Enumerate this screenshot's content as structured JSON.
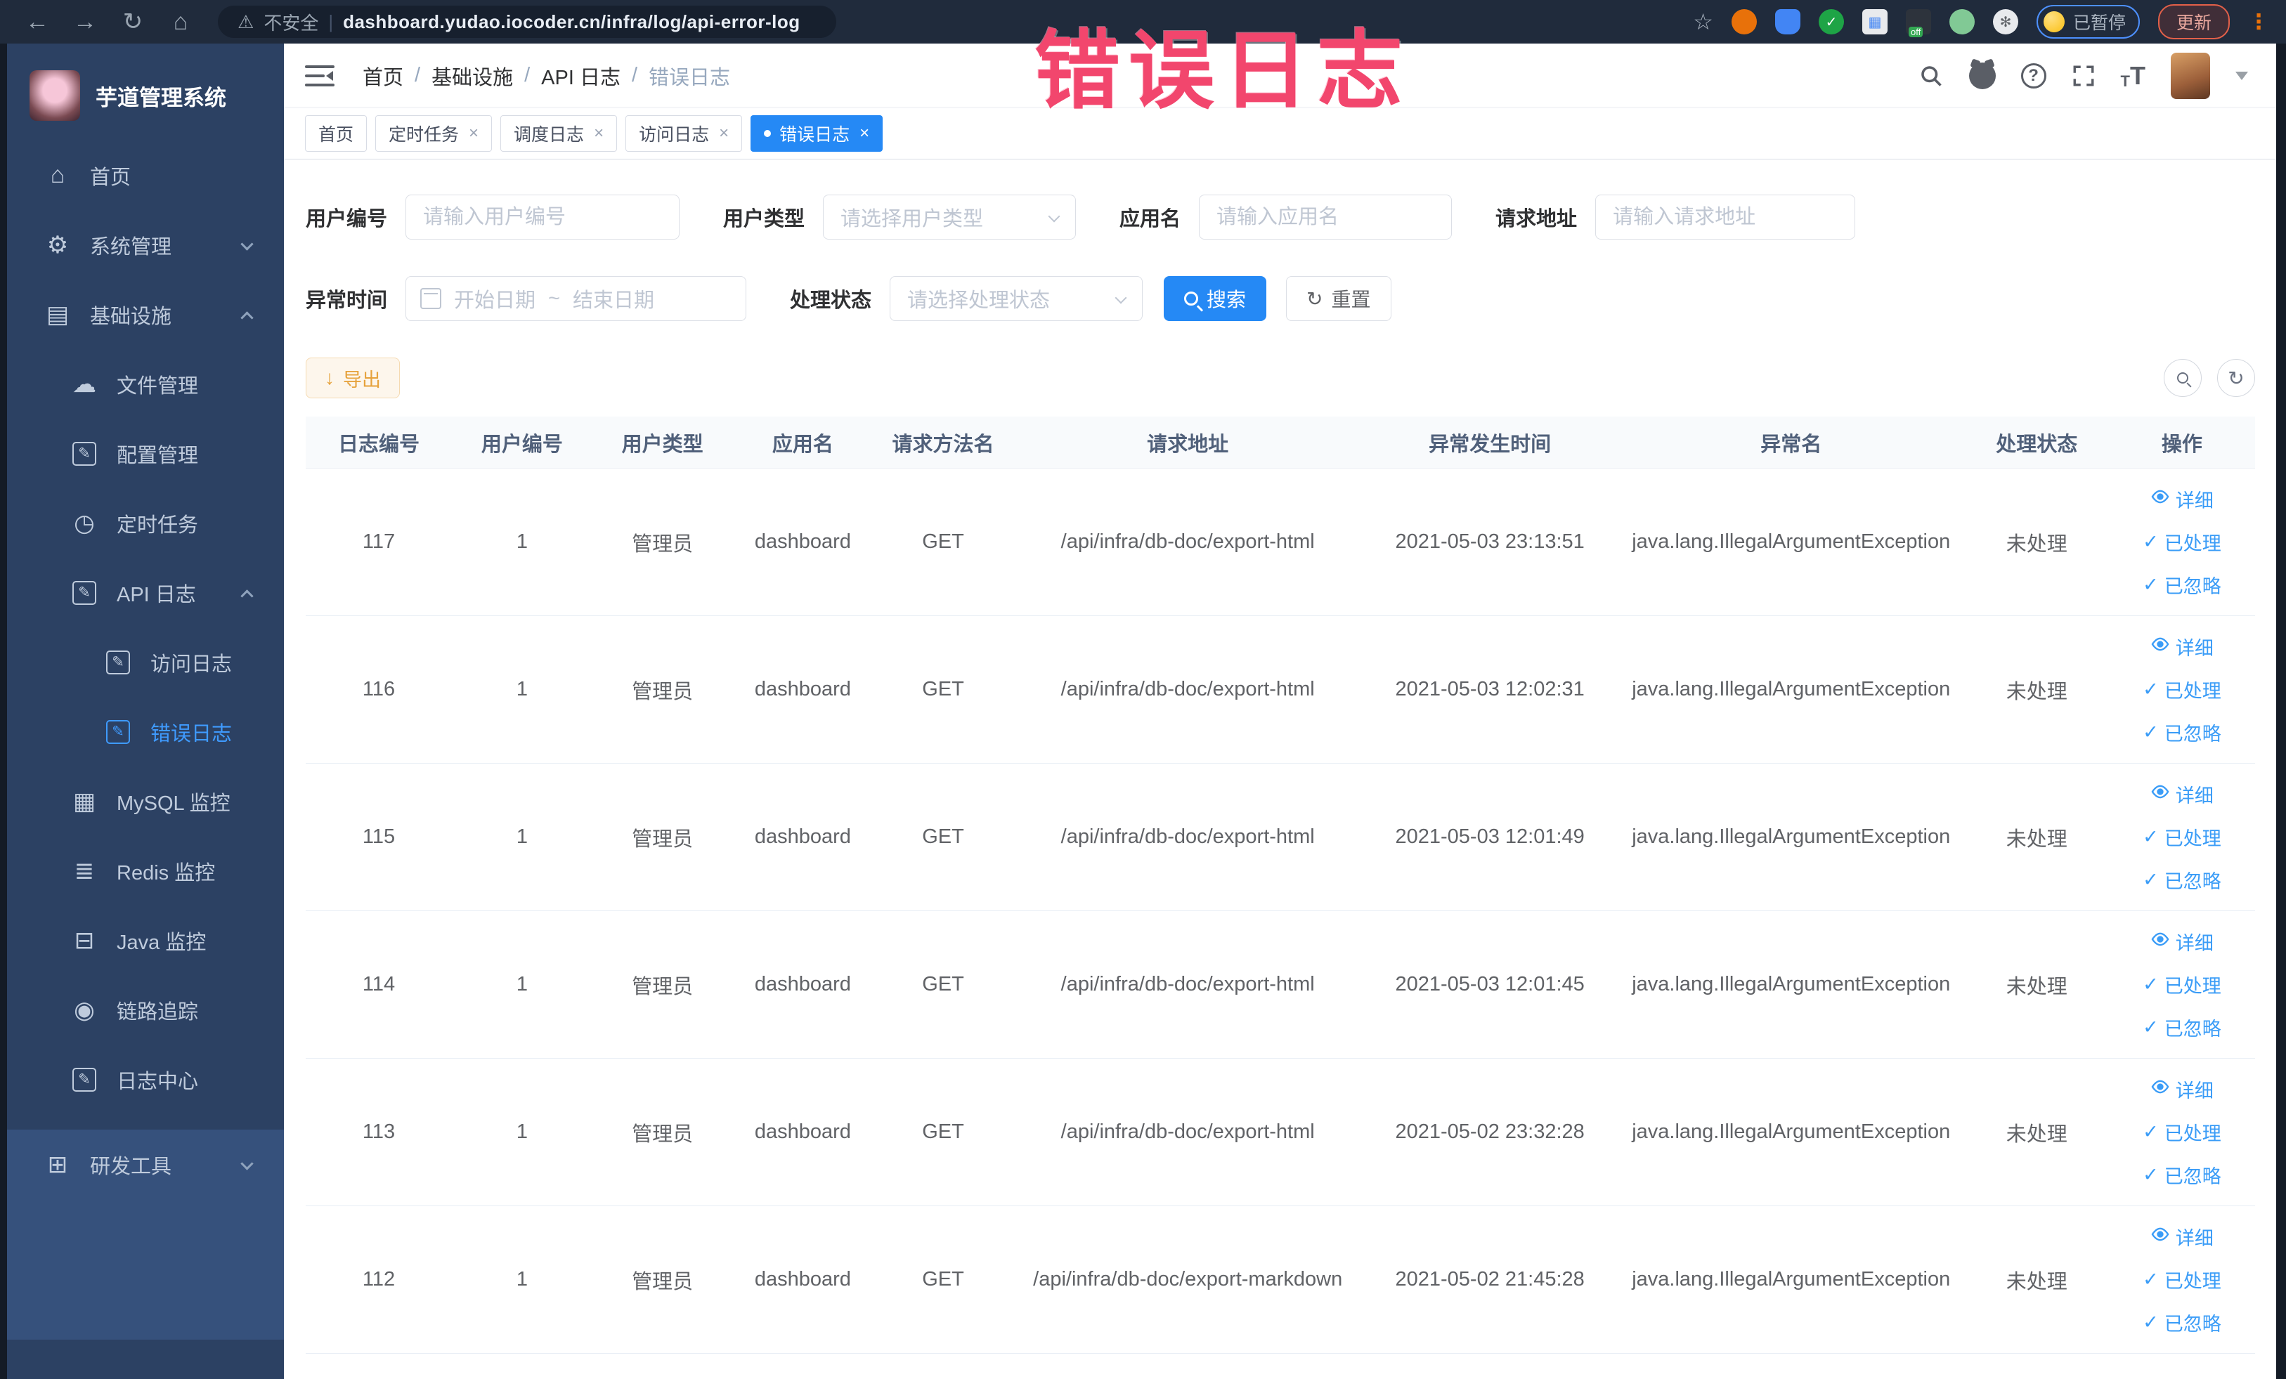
{
  "browser": {
    "security_label": "不安全",
    "url": "dashboard.yudao.iocoder.cn/infra/log/api-error-log",
    "paused_badge": "已暂停",
    "update_label": "更新",
    "extensions": [
      "ext-orange-icon",
      "ext-shield-icon",
      "ext-green-check-icon",
      "ext-grid-icon",
      "ext-off-icon",
      "ext-leaf-icon",
      "ext-puzzle-icon"
    ]
  },
  "annotation": "错误日志",
  "sidebar": {
    "title": "芋道管理系统",
    "menu": [
      {
        "label": "首页",
        "icon": "home",
        "level": 0
      },
      {
        "label": "系统管理",
        "icon": "gear",
        "level": 0,
        "chevron": "down"
      },
      {
        "label": "基础设施",
        "icon": "infrastructure",
        "level": 0,
        "chevron": "up"
      },
      {
        "label": "文件管理",
        "icon": "file-upload",
        "level": 1
      },
      {
        "label": "配置管理",
        "icon": "config-edit",
        "level": 1
      },
      {
        "label": "定时任务",
        "icon": "timer",
        "level": 1
      },
      {
        "label": "API 日志",
        "icon": "api-log",
        "level": 1,
        "chevron": "up"
      },
      {
        "label": "访问日志",
        "icon": "access-log",
        "level": 2
      },
      {
        "label": "错误日志",
        "icon": "error-log",
        "level": 2,
        "active": true
      },
      {
        "label": "MySQL 监控",
        "icon": "mysql-monitor",
        "level": 1
      },
      {
        "label": "Redis 监控",
        "icon": "redis-monitor",
        "level": 1
      },
      {
        "label": "Java 监控",
        "icon": "java-monitor",
        "level": 1
      },
      {
        "label": "链路追踪",
        "icon": "trace",
        "level": 1
      },
      {
        "label": "日志中心",
        "icon": "log-center",
        "level": 1
      },
      {
        "label": "研发工具",
        "icon": "dev-tools",
        "level": 0,
        "chevron": "down",
        "section": "bottom"
      }
    ]
  },
  "breadcrumbs": [
    "首页",
    "基础设施",
    "API 日志",
    "错误日志"
  ],
  "tabs": [
    {
      "label": "首页",
      "closable": false,
      "active": false
    },
    {
      "label": "定时任务",
      "closable": true,
      "active": false
    },
    {
      "label": "调度日志",
      "closable": true,
      "active": false
    },
    {
      "label": "访问日志",
      "closable": true,
      "active": false
    },
    {
      "label": "错误日志",
      "closable": true,
      "active": true
    }
  ],
  "filters": {
    "user_id": {
      "label": "用户编号",
      "placeholder": "请输入用户编号"
    },
    "user_type": {
      "label": "用户类型",
      "placeholder": "请选择用户类型"
    },
    "app_name": {
      "label": "应用名",
      "placeholder": "请输入应用名"
    },
    "request_url": {
      "label": "请求地址",
      "placeholder": "请输入请求地址"
    },
    "exception_time": {
      "label": "异常时间",
      "start_placeholder": "开始日期",
      "separator": "~",
      "end_placeholder": "结束日期"
    },
    "process_status": {
      "label": "处理状态",
      "placeholder": "请选择处理状态"
    },
    "search_label": "搜索",
    "reset_label": "重置"
  },
  "toolbar": {
    "export_label": "导出"
  },
  "table": {
    "headers": [
      "日志编号",
      "用户编号",
      "用户类型",
      "应用名",
      "请求方法名",
      "请求地址",
      "异常发生时间",
      "异常名",
      "处理状态",
      "操作"
    ],
    "actions": [
      "详细",
      "已处理",
      "已忽略"
    ],
    "rows": [
      {
        "id": "117",
        "user_id": "1",
        "user_type": "管理员",
        "app": "dashboard",
        "method": "GET",
        "url": "/api/infra/db-doc/export-html",
        "time": "2021-05-03 23:13:51",
        "exception": "java.lang.IllegalArgumentException",
        "status": "未处理"
      },
      {
        "id": "116",
        "user_id": "1",
        "user_type": "管理员",
        "app": "dashboard",
        "method": "GET",
        "url": "/api/infra/db-doc/export-html",
        "time": "2021-05-03 12:02:31",
        "exception": "java.lang.IllegalArgumentException",
        "status": "未处理"
      },
      {
        "id": "115",
        "user_id": "1",
        "user_type": "管理员",
        "app": "dashboard",
        "method": "GET",
        "url": "/api/infra/db-doc/export-html",
        "time": "2021-05-03 12:01:49",
        "exception": "java.lang.IllegalArgumentException",
        "status": "未处理"
      },
      {
        "id": "114",
        "user_id": "1",
        "user_type": "管理员",
        "app": "dashboard",
        "method": "GET",
        "url": "/api/infra/db-doc/export-html",
        "time": "2021-05-03 12:01:45",
        "exception": "java.lang.IllegalArgumentException",
        "status": "未处理"
      },
      {
        "id": "113",
        "user_id": "1",
        "user_type": "管理员",
        "app": "dashboard",
        "method": "GET",
        "url": "/api/infra/db-doc/export-html",
        "time": "2021-05-02 23:32:28",
        "exception": "java.lang.IllegalArgumentException",
        "status": "未处理"
      },
      {
        "id": "112",
        "user_id": "1",
        "user_type": "管理员",
        "app": "dashboard",
        "method": "GET",
        "url": "/api/infra/db-doc/export-markdown",
        "time": "2021-05-02 21:45:28",
        "exception": "java.lang.IllegalArgumentException",
        "status": "未处理"
      }
    ]
  }
}
